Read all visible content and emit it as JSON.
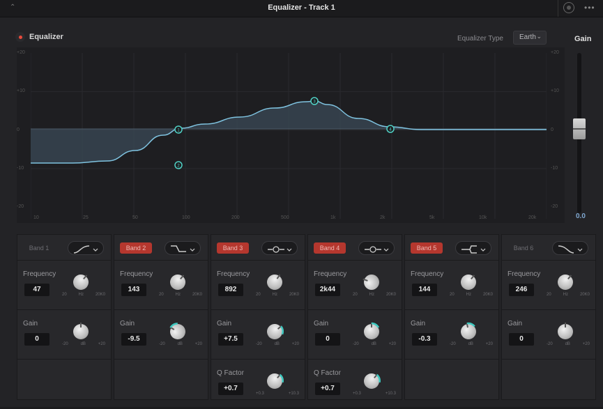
{
  "window": {
    "title": "Equalizer - Track 1"
  },
  "header": {
    "eq_label": "Equalizer",
    "eq_type_label": "Equalizer Type",
    "eq_type_value": "Earth",
    "gain_title": "Gain"
  },
  "graph": {
    "y_left_ticks": [
      "+20",
      "+10",
      "0",
      "-10",
      "-20"
    ],
    "y_right_ticks": [
      "+20",
      "+10",
      "0",
      "-10",
      "-20"
    ],
    "x_ticks": [
      "10",
      "25",
      "50",
      "100",
      "200",
      "500",
      "1k",
      "2k",
      "5k",
      "10k",
      "20k"
    ],
    "curve_color": "#7fc3e0",
    "node_labels": [
      "1",
      "2",
      "3",
      "4"
    ]
  },
  "fader": {
    "value": "0.0",
    "level_db": 0
  },
  "bands": [
    {
      "label": "Band 1",
      "active": false,
      "shape": "low-cut",
      "frequency": {
        "name": "Frequency",
        "value": "47",
        "scale": [
          "20",
          "Hz",
          "20K0"
        ]
      },
      "gain": {
        "name": "Gain",
        "value": "0",
        "scale": [
          "-20",
          "dB",
          "+20"
        ]
      }
    },
    {
      "label": "Band 2",
      "active": true,
      "shape": "low-shelf",
      "frequency": {
        "name": "Frequency",
        "value": "143",
        "scale": [
          "20",
          "Hz",
          "20K0"
        ]
      },
      "gain": {
        "name": "Gain",
        "value": "-9.5",
        "scale": [
          "-20",
          "dB",
          "+20"
        ]
      }
    },
    {
      "label": "Band 3",
      "active": true,
      "shape": "bell",
      "frequency": {
        "name": "Frequency",
        "value": "892",
        "scale": [
          "20",
          "Hz",
          "20K0"
        ]
      },
      "gain": {
        "name": "Gain",
        "value": "+7.5",
        "scale": [
          "-20",
          "dB",
          "+20"
        ]
      },
      "q": {
        "name": "Q Factor",
        "value": "+0.7",
        "scale": [
          "+0.3",
          "+10.3"
        ]
      }
    },
    {
      "label": "Band 4",
      "active": true,
      "shape": "bell",
      "frequency": {
        "name": "Frequency",
        "value": "2k44",
        "scale": [
          "20",
          "Hz",
          "20K0"
        ]
      },
      "gain": {
        "name": "Gain",
        "value": "0",
        "scale": [
          "-20",
          "dB",
          "+20"
        ]
      },
      "q": {
        "name": "Q Factor",
        "value": "+0.7",
        "scale": [
          "+0.3",
          "+10.3"
        ]
      }
    },
    {
      "label": "Band 5",
      "active": true,
      "shape": "high-shelf",
      "frequency": {
        "name": "Frequency",
        "value": "144",
        "scale": [
          "20",
          "Hz",
          "20K0"
        ]
      },
      "gain": {
        "name": "Gain",
        "value": "-0.3",
        "scale": [
          "-20",
          "dB",
          "+20"
        ]
      }
    },
    {
      "label": "Band 6",
      "active": false,
      "shape": "high-cut",
      "frequency": {
        "name": "Frequency",
        "value": "246",
        "scale": [
          "20",
          "Hz",
          "20K0"
        ]
      },
      "gain": {
        "name": "Gain",
        "value": "0",
        "scale": [
          "-20",
          "dB",
          "+20"
        ]
      }
    }
  ]
}
